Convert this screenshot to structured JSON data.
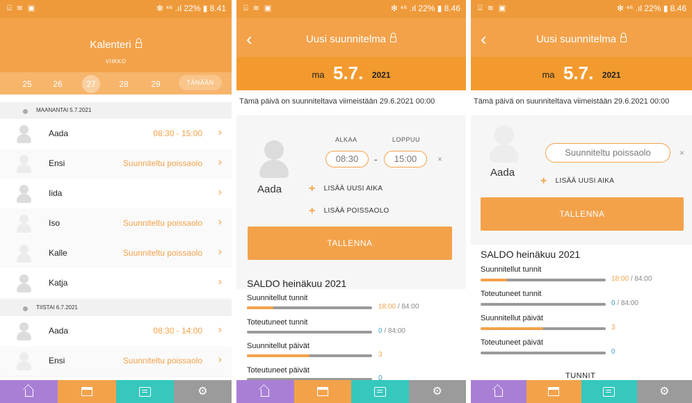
{
  "status_bar": {
    "left": "⌸ ≋ ▣",
    "right": "✻ ⁴⁶ .ıl 22% ▮ "
  },
  "calendar": {
    "status_time": "8.41",
    "title": "Kalenteri",
    "week_label": "VIIKKO",
    "weeks": [
      "25",
      "26",
      "27",
      "28",
      "29"
    ],
    "selected_week": "27",
    "today_label": "TÄNÄÄN",
    "days": [
      {
        "header": "MAANANTAI 5.7.2021",
        "rows": [
          {
            "name": "Aada",
            "status": "08:30 - 15:00"
          },
          {
            "name": "Ensi",
            "status": "Suunniteltu poissaolo"
          },
          {
            "name": "Iida",
            "status": ""
          },
          {
            "name": "Iso",
            "status": "Suunniteltu poissaolo"
          },
          {
            "name": "Kalle",
            "status": "Suunniteltu poissaolo"
          },
          {
            "name": "Katja",
            "status": ""
          }
        ]
      },
      {
        "header": "TIISTAI 6.7.2021",
        "rows": [
          {
            "name": "Aada",
            "status": "08:30 - 14:00"
          },
          {
            "name": "Ensi",
            "status": "Suunniteltu poissaolo"
          }
        ]
      }
    ]
  },
  "plan_a": {
    "status_time": "8.46",
    "title": "Uusi suunnitelma",
    "date_weekday": "ma",
    "date_day": "5.7.",
    "date_year": "2021",
    "notice": "Tämä päivä on suunniteltava viimeistään 29.6.2021 00:00",
    "person": "Aada",
    "start_label": "ALKAA",
    "end_label": "LOPPUU",
    "start_time": "08:30",
    "end_time": "15:00",
    "dash": "-",
    "remove": "×",
    "add_time": "LISÄÄ UUSI AIKA",
    "add_absence": "LISÄÄ POISSAOLO",
    "save": "TALLENNA",
    "saldo_title": "SALDO heinäkuu 2021",
    "stats": [
      {
        "label": "Suunnitellut tunnit",
        "value": "18:00",
        "total": "/ 84:00",
        "fraction": 0.21,
        "blue": false
      },
      {
        "label": "Toteutuneet tunnit",
        "value": "0",
        "total": "/ 84:00",
        "fraction": 0,
        "blue": true
      },
      {
        "label": "Suunnitellut päivät",
        "value": "3",
        "total": "",
        "fraction": 0.5,
        "blue": false
      },
      {
        "label": "Toteutuneet päivät",
        "value": "0",
        "total": "",
        "fraction": 0,
        "blue": true
      }
    ]
  },
  "plan_b": {
    "status_time": "8.46",
    "title": "Uusi suunnitelma",
    "date_weekday": "ma",
    "date_day": "5.7.",
    "date_year": "2021",
    "notice": "Tämä päivä on suunniteltava viimeistään 29.6.2021 00:00",
    "person": "Aada",
    "absence": "Suunniteltu poissaolo",
    "remove": "×",
    "add_time": "LISÄÄ UUSI AIKA",
    "save": "TALLENNA",
    "saldo_title": "SALDO heinäkuu 2021",
    "stats": [
      {
        "label": "Suunnitellut tunnit",
        "value": "18:00",
        "total": "/ 84:00",
        "fraction": 0.21,
        "blue": false
      },
      {
        "label": "Toteutuneet tunnit",
        "value": "0",
        "total": "/ 84:00",
        "fraction": 0,
        "blue": true
      },
      {
        "label": "Suunnitellut päivät",
        "value": "3",
        "total": "",
        "fraction": 0.5,
        "blue": false
      },
      {
        "label": "Toteutuneet päivät",
        "value": "0",
        "total": "",
        "fraction": 0,
        "blue": true
      }
    ],
    "tunnit": "TUNNIT"
  },
  "nav_icons": [
    "home-icon",
    "calendar-icon",
    "message-icon",
    "settings-icon"
  ]
}
